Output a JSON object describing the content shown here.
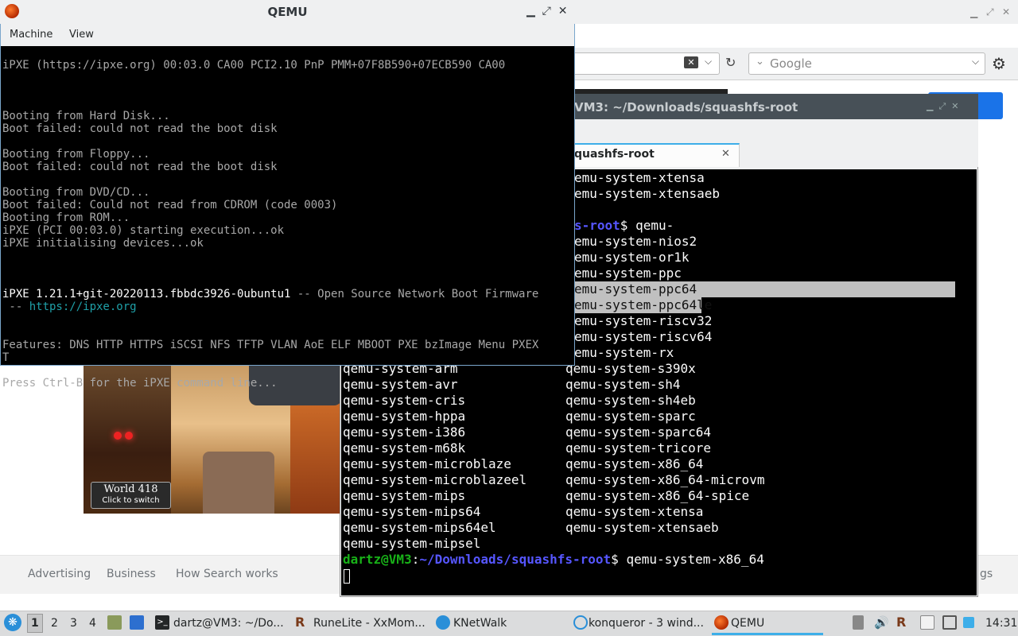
{
  "browser": {
    "search_placeholder": "Google",
    "footer": {
      "advertising": "Advertising",
      "business": "Business",
      "how_search_works": "How Search works",
      "settings_partial": "gs"
    },
    "game_badge": {
      "title": "World 418",
      "subtitle": "Click to switch"
    }
  },
  "qemu": {
    "title": "QEMU",
    "menu": {
      "machine": "Machine",
      "view": "View"
    },
    "lines": [
      "iPXE (https://ipxe.org) 00:03.0 CA00 PCI2.10 PnP PMM+07F8B590+07ECB590 CA00",
      "",
      "",
      "",
      "Booting from Hard Disk...",
      "Boot failed: could not read the boot disk",
      "",
      "Booting from Floppy...",
      "Boot failed: could not read the boot disk",
      "",
      "Booting from DVD/CD...",
      "Boot failed: Could not read from CDROM (code 0003)",
      "Booting from ROM...",
      "iPXE (PCI 00:03.0) starting execution...ok",
      "iPXE initialising devices...ok",
      "",
      "",
      "",
      "",
      "",
      "Features: DNS HTTP HTTPS iSCSI NFS TFTP VLAN AoE ELF MBOOT PXE bzImage Menu PXEX",
      "T",
      "",
      "Press Ctrl-B for the iPXE command line..."
    ],
    "version_line": {
      "bright": "iPXE 1.21.1+git-20220113.fbbdc3926-0ubuntu1",
      "rest": " -- Open Source Network Boot Firmware"
    },
    "url_line": {
      "prefix": " -- ",
      "url": "https://ipxe.org"
    }
  },
  "terminal": {
    "title": "VM3: ~/Downloads/squashfs-root",
    "tab_label": "quashfs-root",
    "top_lines": [
      "emu-system-xtensa",
      "emu-system-xtensaeb",
      "",
      "",
      "emu-system-nios2",
      "emu-system-or1k",
      "emu-system-ppc",
      "emu-system-ppc64",
      "emu-system-ppc64le",
      "emu-system-riscv32",
      "emu-system-riscv64",
      "emu-system-rx"
    ],
    "prompt_partial": {
      "path": "s-root",
      "rest": "$ qemu-"
    },
    "col1": [
      "qemu-system-arm",
      "qemu-system-avr",
      "qemu-system-cris",
      "qemu-system-hppa",
      "qemu-system-i386",
      "qemu-system-m68k",
      "qemu-system-microblaze",
      "qemu-system-microblazeel",
      "qemu-system-mips",
      "qemu-system-mips64",
      "qemu-system-mips64el",
      "qemu-system-mipsel"
    ],
    "col2": [
      "qemu-system-s390x",
      "qemu-system-sh4",
      "qemu-system-sh4eb",
      "qemu-system-sparc",
      "qemu-system-sparc64",
      "qemu-system-tricore",
      "qemu-system-x86_64",
      "qemu-system-x86_64-microvm",
      "qemu-system-x86_64-spice",
      "qemu-system-xtensa",
      "qemu-system-xtensaeb"
    ],
    "final_prompt": {
      "user": "dartz@VM3",
      "colon": ":",
      "path": "~/Downloads/squashfs-root",
      "command": "$ qemu-system-x86_64"
    }
  },
  "taskbar": {
    "desktops": [
      "1",
      "2",
      "3",
      "4"
    ],
    "tasks": {
      "terminal": "dartz@VM3: ~/Do...",
      "runelite": "RuneLite - XxMom...",
      "knetwalk": "KNetWalk",
      "konqueror": "konqueror - 3 wind...",
      "qemu": "QEMU"
    },
    "clock": "14:31",
    "colors": {
      "accent": "#3daee9",
      "background": "#dbdcdd"
    }
  }
}
